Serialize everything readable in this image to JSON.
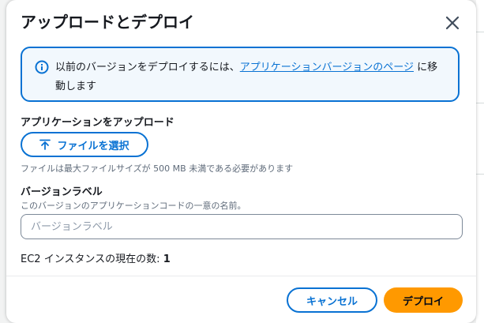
{
  "modal": {
    "title": "アップロードとデプロイ",
    "close_icon": "close-icon"
  },
  "alert": {
    "icon": "info-icon",
    "text_before": "以前のバージョンをデプロイするには、",
    "link_text": "アプリケーションバージョンのページ",
    "text_after": " に移動します"
  },
  "upload": {
    "label": "アプリケーションをアップロード",
    "button_label": "ファイルを選択",
    "button_icon": "upload-icon",
    "constraint": "ファイルは最大ファイルサイズが 500 MB 未満である必要があります"
  },
  "version": {
    "label": "バージョンラベル",
    "description": "このバージョンのアプリケーションコードの一意の名前。",
    "placeholder": "バージョンラベル",
    "value": ""
  },
  "instances": {
    "label": "EC2 インスタンスの現在の数: ",
    "count": "1"
  },
  "footer": {
    "cancel_label": "キャンセル",
    "deploy_label": "デプロイ"
  },
  "colors": {
    "accent": "#0972d3",
    "primary_button": "#ff9900",
    "alert_background": "#f2f8fd"
  }
}
